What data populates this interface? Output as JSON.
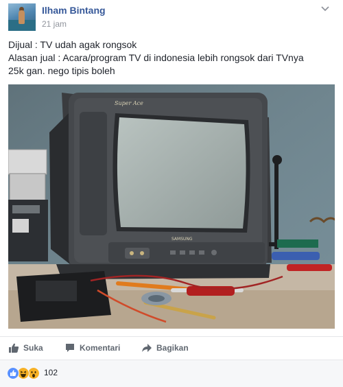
{
  "post": {
    "author": "Ilham Bintang",
    "timestamp": "21 jam",
    "lines": [
      "Dijual : TV udah agak rongsok",
      "Alasan jual : Acara/program TV di indonesia lebih rongsok dari TVnya",
      "25k gan. nego tipis boleh"
    ],
    "photo_text": {
      "brand_script": "Super Ace",
      "logo": "SAMSUNG"
    }
  },
  "actions": {
    "like_label": "Suka",
    "comment_label": "Komentari",
    "share_label": "Bagikan"
  },
  "reactions": {
    "types": [
      "like",
      "haha",
      "wow"
    ],
    "count": "102"
  },
  "colors": {
    "name_link": "#365899",
    "meta_gray": "#90949c",
    "like_blue": "#5890ff",
    "emoji_yellow": "#f7b125"
  }
}
